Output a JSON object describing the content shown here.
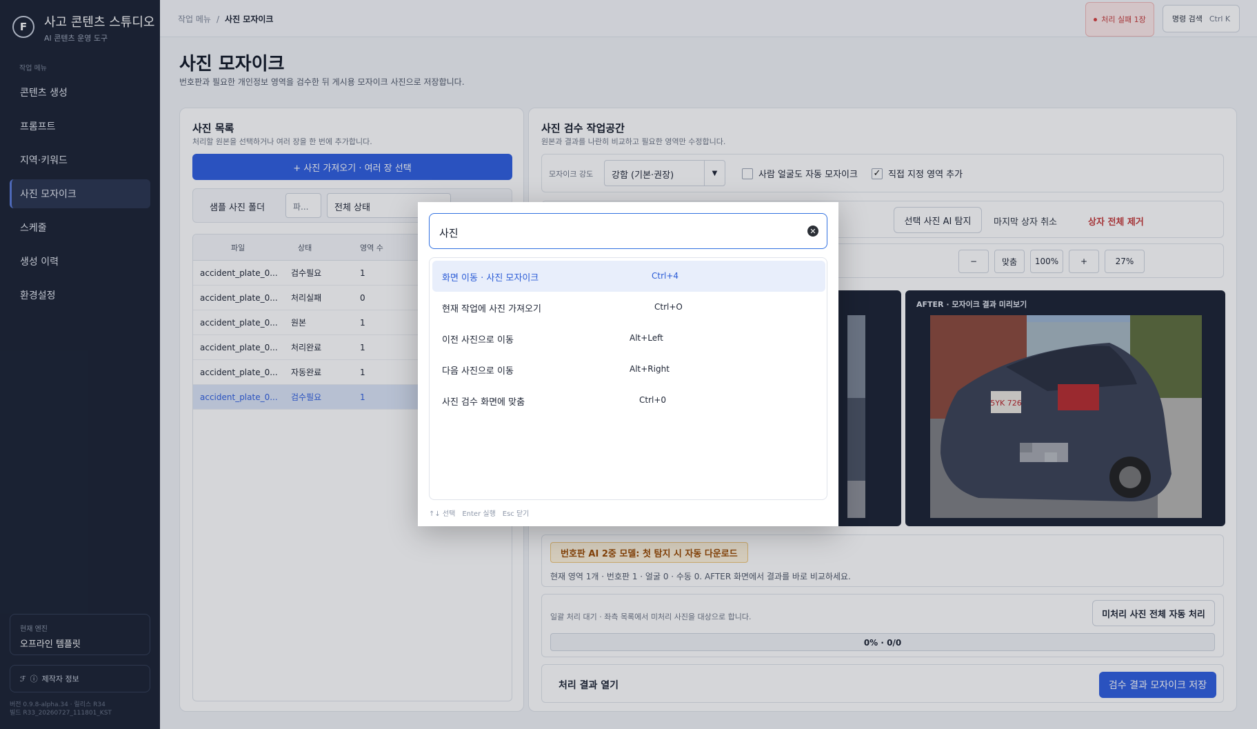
{
  "brand": {
    "title": "사고 콘텐츠 스튜디오",
    "subtitle": "AI 콘텐츠 운영 도구",
    "logo": "F"
  },
  "sidebar": {
    "section_label": "작업 메뉴",
    "items": [
      {
        "label": "콘텐츠 생성"
      },
      {
        "label": "프롬프트"
      },
      {
        "label": "지역·키워드"
      },
      {
        "label": "사진 모자이크"
      },
      {
        "label": "스케줄"
      },
      {
        "label": "생성 이력"
      },
      {
        "label": "환경설정"
      }
    ],
    "engine_label": "현재 엔진",
    "engine_value": "오프라인 템플릿",
    "maker_label": "제작자 정보",
    "version_line1": "버전 0.9.8-alpha.34 · 릴리스 R34",
    "version_line2": "빌드 R33_20260727_111801_KST"
  },
  "topbar": {
    "breadcrumb_root": "작업 메뉴",
    "breadcrumb_sep": "/",
    "breadcrumb_current": "사진 모자이크",
    "fail_badge": "처리 실패 1장",
    "command_search": "명령 검색",
    "command_shortcut": "Ctrl K"
  },
  "page": {
    "title": "사진 모자이크",
    "description": "번호판과 필요한 개인정보 영역을 검수한 뒤 게시용 모자이크 사진으로 저장합니다."
  },
  "photo_list": {
    "title": "사진 목록",
    "subtitle": "처리할 원본을 선택하거나 여러 장을 한 번에 추가합니다.",
    "import_button": "+ 사진 가져오기 · 여러 장 선택",
    "sample_folder": "샘플 사진 폴더",
    "file_filter_placeholder": "파...",
    "status_filter": "전체 상태",
    "columns": [
      "파일",
      "상태",
      "영역 수"
    ],
    "rows": [
      {
        "file": "accident_plate_0...",
        "status": "검수필요",
        "regions": "1"
      },
      {
        "file": "accident_plate_0...",
        "status": "처리실패",
        "regions": "0"
      },
      {
        "file": "accident_plate_0...",
        "status": "원본",
        "regions": "1"
      },
      {
        "file": "accident_plate_0...",
        "status": "처리완료",
        "regions": "1"
      },
      {
        "file": "accident_plate_0...",
        "status": "자동완료",
        "regions": "1"
      },
      {
        "file": "accident_plate_0...",
        "status": "검수필요",
        "regions": "1"
      }
    ]
  },
  "workspace": {
    "title": "사진 검수 작업공간",
    "subtitle": "원본과 결과를 나란히 비교하고 필요한 영역만 수정합니다.",
    "strength_label": "모자이크 강도",
    "strength_value": "강함 (기본·권장)",
    "face_checkbox": "사람 얼굴도 자동 모자이크",
    "face_checked": false,
    "manual_checkbox": "직접 지정 영역 추가",
    "manual_checked": true,
    "ai_detect_button": "선택 사진 AI 탐지",
    "undo_box_button": "마지막 상자 취소",
    "remove_all_button": "상자 전체 제거",
    "zoom_out": "−",
    "zoom_fit": "맞춤",
    "zoom_100": "100%",
    "zoom_in": "+",
    "zoom_level": "27%",
    "after_label": "AFTER · 모자이크 결과 미리보기",
    "ai_badge": "번호판 AI 2중 모델: 첫 탐지 시 자동 다운로드",
    "region_summary": "현재 영역 1개 · 번호판 1 · 얼굴 0 · 수동 0. AFTER 화면에서 결과를 바로 비교하세요.",
    "batch_text": "일괄 처리 대기 · 좌측 목록에서 미처리 사진을 대상으로 합니다.",
    "batch_button": "미처리 사진 전체 자동 처리",
    "progress_text": "0% · 0/0",
    "progress_value": 0,
    "open_results": "처리 결과 열기",
    "save_button": "검수 결과 모자이크 저장",
    "plate_text": "5YK 726"
  },
  "palette": {
    "query": "사진",
    "items": [
      {
        "label": "화면 이동 · 사진 모자이크",
        "shortcut": "Ctrl+4"
      },
      {
        "label": "현재 작업에 사진 가져오기",
        "shortcut": "Ctrl+O"
      },
      {
        "label": "이전 사진으로 이동",
        "shortcut": "Alt+Left"
      },
      {
        "label": "다음 사진으로 이동",
        "shortcut": "Alt+Right"
      },
      {
        "label": "사진 검수 화면에 맞춤",
        "shortcut": "Ctrl+0"
      }
    ],
    "footer_select": "↑↓ 선택",
    "footer_enter": "Enter 실행",
    "footer_esc": "Esc 닫기"
  },
  "colors": {
    "accent": "#2f5fe0",
    "sidebar": "#1b2334",
    "danger": "#c43a3a"
  }
}
